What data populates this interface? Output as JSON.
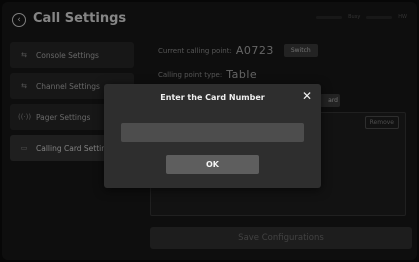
{
  "header": {
    "title": "Call Settings",
    "status": {
      "network": "Busy",
      "extra": "HW"
    }
  },
  "sidebar": {
    "items": [
      {
        "label": "Console Settings",
        "icon": "sliders-icon"
      },
      {
        "label": "Channel Settings",
        "icon": "sliders-icon"
      },
      {
        "label": "Pager Settings",
        "icon": "signal-icon"
      },
      {
        "label": "Calling Card Settings",
        "icon": "card-icon",
        "active": true
      }
    ]
  },
  "content": {
    "current_point_label": "Current calling point:",
    "current_point_value": "A0723",
    "switch_label": "Switch",
    "point_type_label": "Calling point type:",
    "point_type_value": "Table",
    "card_button_label": "ard",
    "remove_label": "Remove",
    "save_label": "Save Configurations"
  },
  "dialog": {
    "title": "Enter the Card Number",
    "input_value": "",
    "input_placeholder": "",
    "ok_label": "OK"
  }
}
